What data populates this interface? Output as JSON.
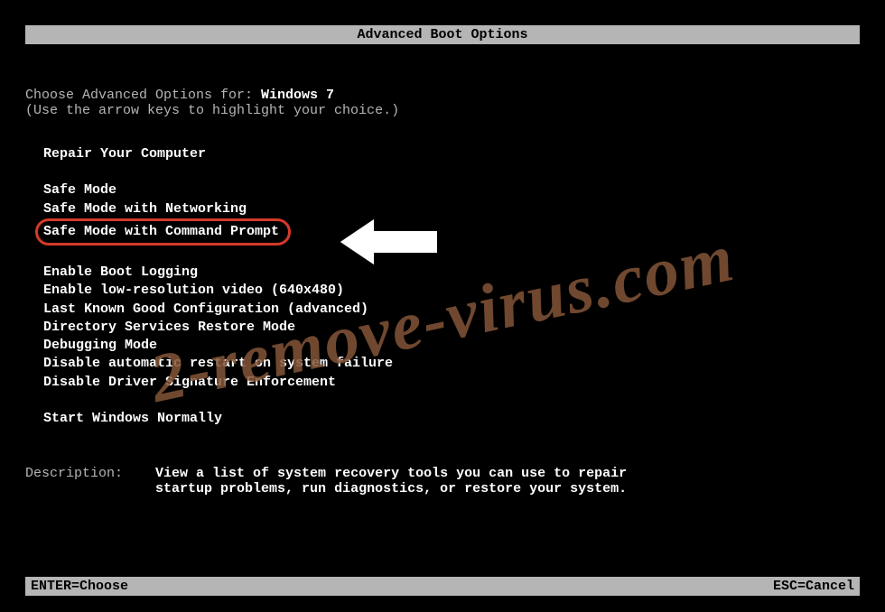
{
  "title": "Advanced Boot Options",
  "intro": {
    "prefix": "Choose Advanced Options for: ",
    "os": "Windows 7",
    "hint": "(Use the arrow keys to highlight your choice.)"
  },
  "menu": {
    "repair": "Repair Your Computer",
    "items": [
      "Safe Mode",
      "Safe Mode with Networking",
      "Safe Mode with Command Prompt"
    ],
    "items2": [
      "Enable Boot Logging",
      "Enable low-resolution video (640x480)",
      "Last Known Good Configuration (advanced)",
      "Directory Services Restore Mode",
      "Debugging Mode",
      "Disable automatic restart on system failure",
      "Disable Driver Signature Enforcement"
    ],
    "start_normal": "Start Windows Normally"
  },
  "description": {
    "label": "Description:    ",
    "text": "View a list of system recovery tools you can use to repair startup problems, run diagnostics, or restore your system."
  },
  "footer": {
    "enter": "ENTER=Choose",
    "esc": "ESC=Cancel"
  },
  "watermark": "2-remove-virus.com",
  "annotation": {
    "highlighted_index": 2,
    "colors": {
      "highlight_border": "#d43a2a",
      "arrow_fill": "#ffffff"
    }
  }
}
